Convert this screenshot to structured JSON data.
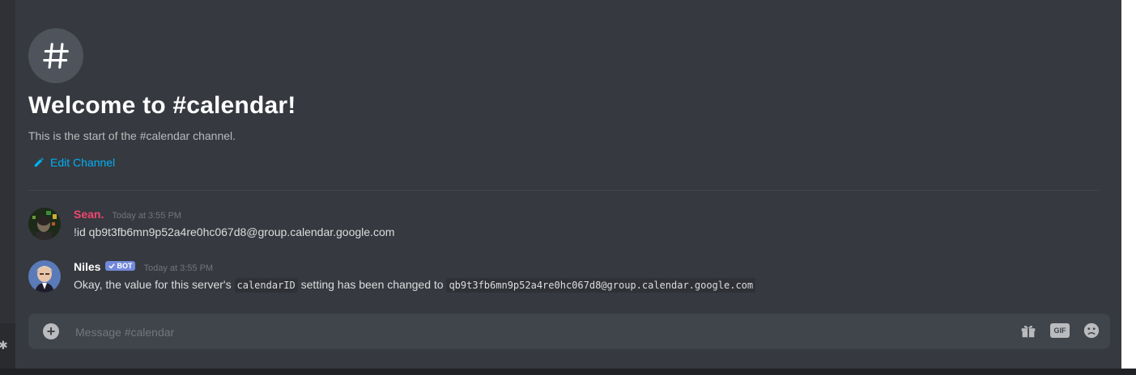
{
  "channel": {
    "welcome_title": "Welcome to #calendar!",
    "welcome_subtitle": "This is the start of the #calendar channel.",
    "edit_label": "Edit Channel"
  },
  "messages": [
    {
      "author": "Sean.",
      "author_color": "#f04770",
      "timestamp": "Today at 3:55 PM",
      "content": "!id qb9t3fb6mn9p52a4re0hc067d8@group.calendar.google.com"
    },
    {
      "author": "Niles",
      "author_color": "#ffffff",
      "bot_tag": "BOT",
      "timestamp": "Today at 3:55 PM",
      "content_parts": {
        "p1": "Okay, the value for this server's ",
        "code1": "calendarID",
        "p2": " setting has been changed to ",
        "code2": "qb9t3fb6mn9p52a4re0hc067d8@group.calendar.google.com"
      }
    }
  ],
  "composer": {
    "placeholder": "Message #calendar",
    "gif_label": "GIF"
  },
  "icons": {
    "channel": "hash-icon",
    "edit": "pencil-icon",
    "add": "plus-icon",
    "gift": "gift-icon",
    "gif": "gif-icon",
    "emoji": "emoji-icon"
  },
  "colors": {
    "background": "#36393f",
    "link": "#00b0f4",
    "bot_tag": "#7289da"
  }
}
